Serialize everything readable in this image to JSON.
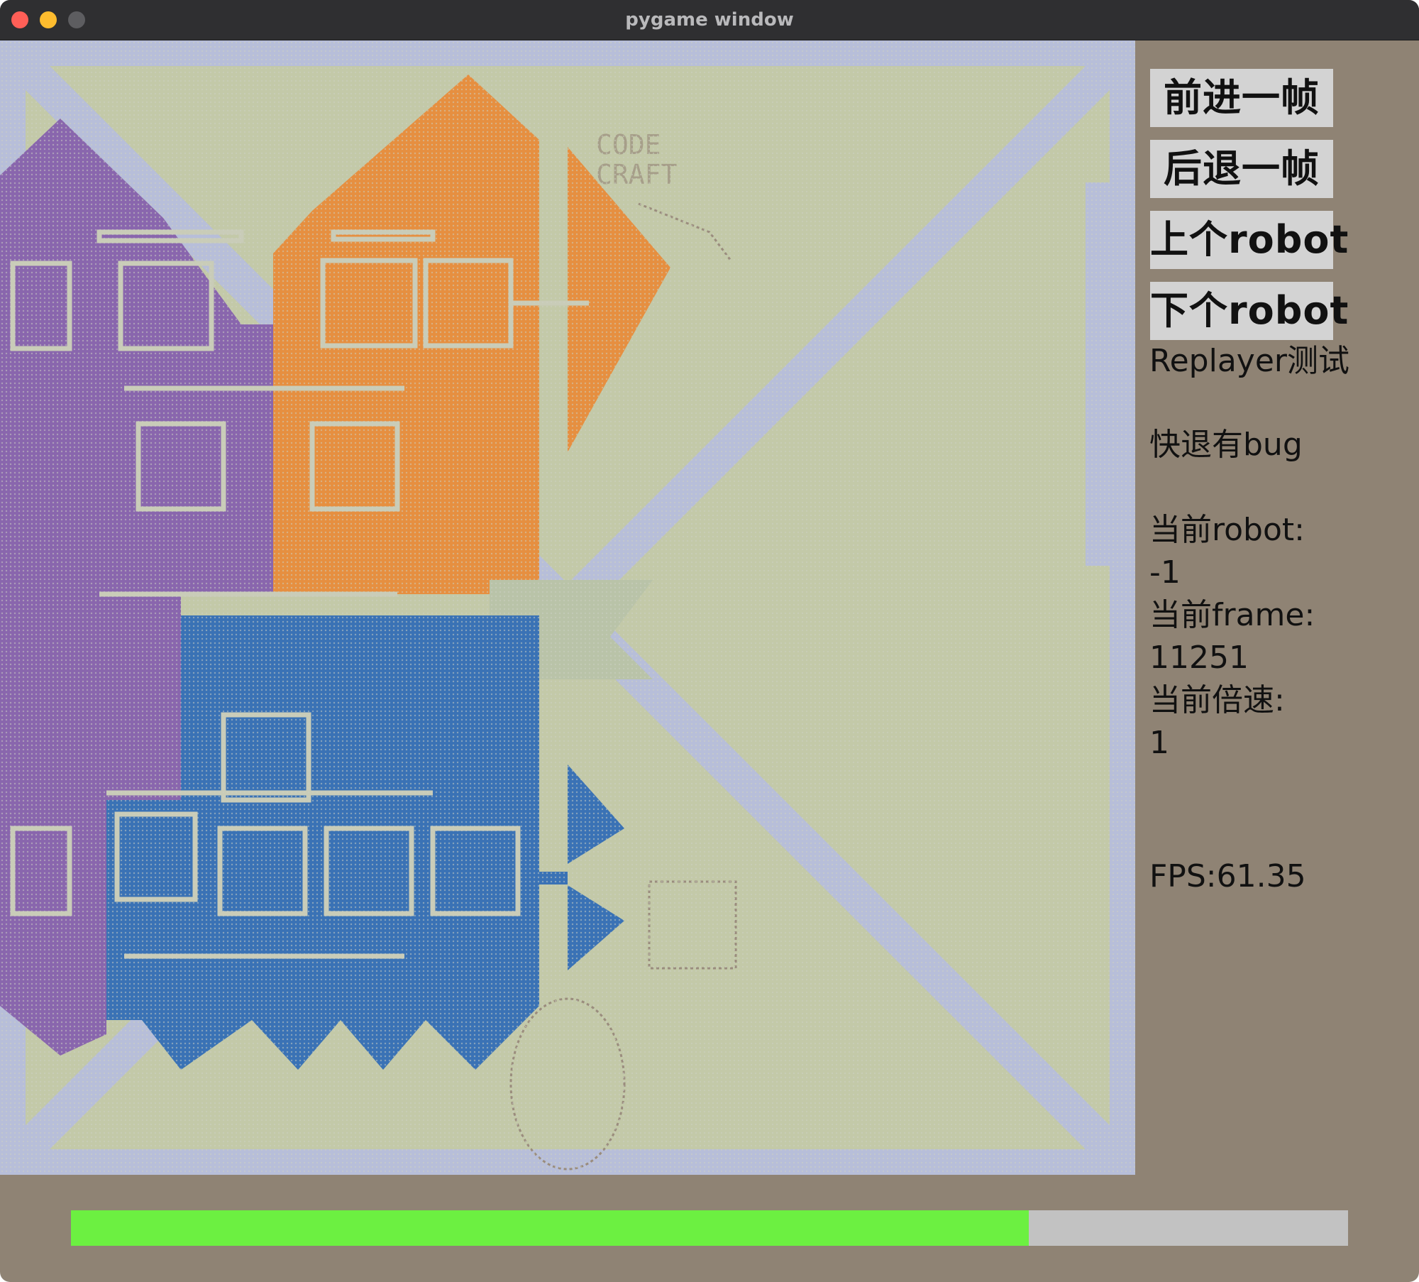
{
  "window": {
    "title": "pygame window"
  },
  "controls": {
    "next_frame": "前进一帧",
    "prev_frame": "后退一帧",
    "prev_robot": "上个robot",
    "next_robot": "下个robot"
  },
  "info": {
    "heading": "Replayer测试",
    "note": "快退有bug",
    "current_robot_label": "当前robot:",
    "current_robot_value": "-1",
    "current_frame_label": "当前frame:",
    "current_frame_value": "11251",
    "speed_label": "当前倍速:",
    "speed_value": "1",
    "fps": "FPS:61.35"
  },
  "progress": {
    "fraction": 0.75
  },
  "map": {
    "colors": {
      "ground": "#c3c9a8",
      "road": "#b7bed9",
      "purple_team": "#8966ad",
      "orange_team": "#e68f40",
      "blue_team": "#3a72b5",
      "wall": "#c9ccb8"
    }
  }
}
